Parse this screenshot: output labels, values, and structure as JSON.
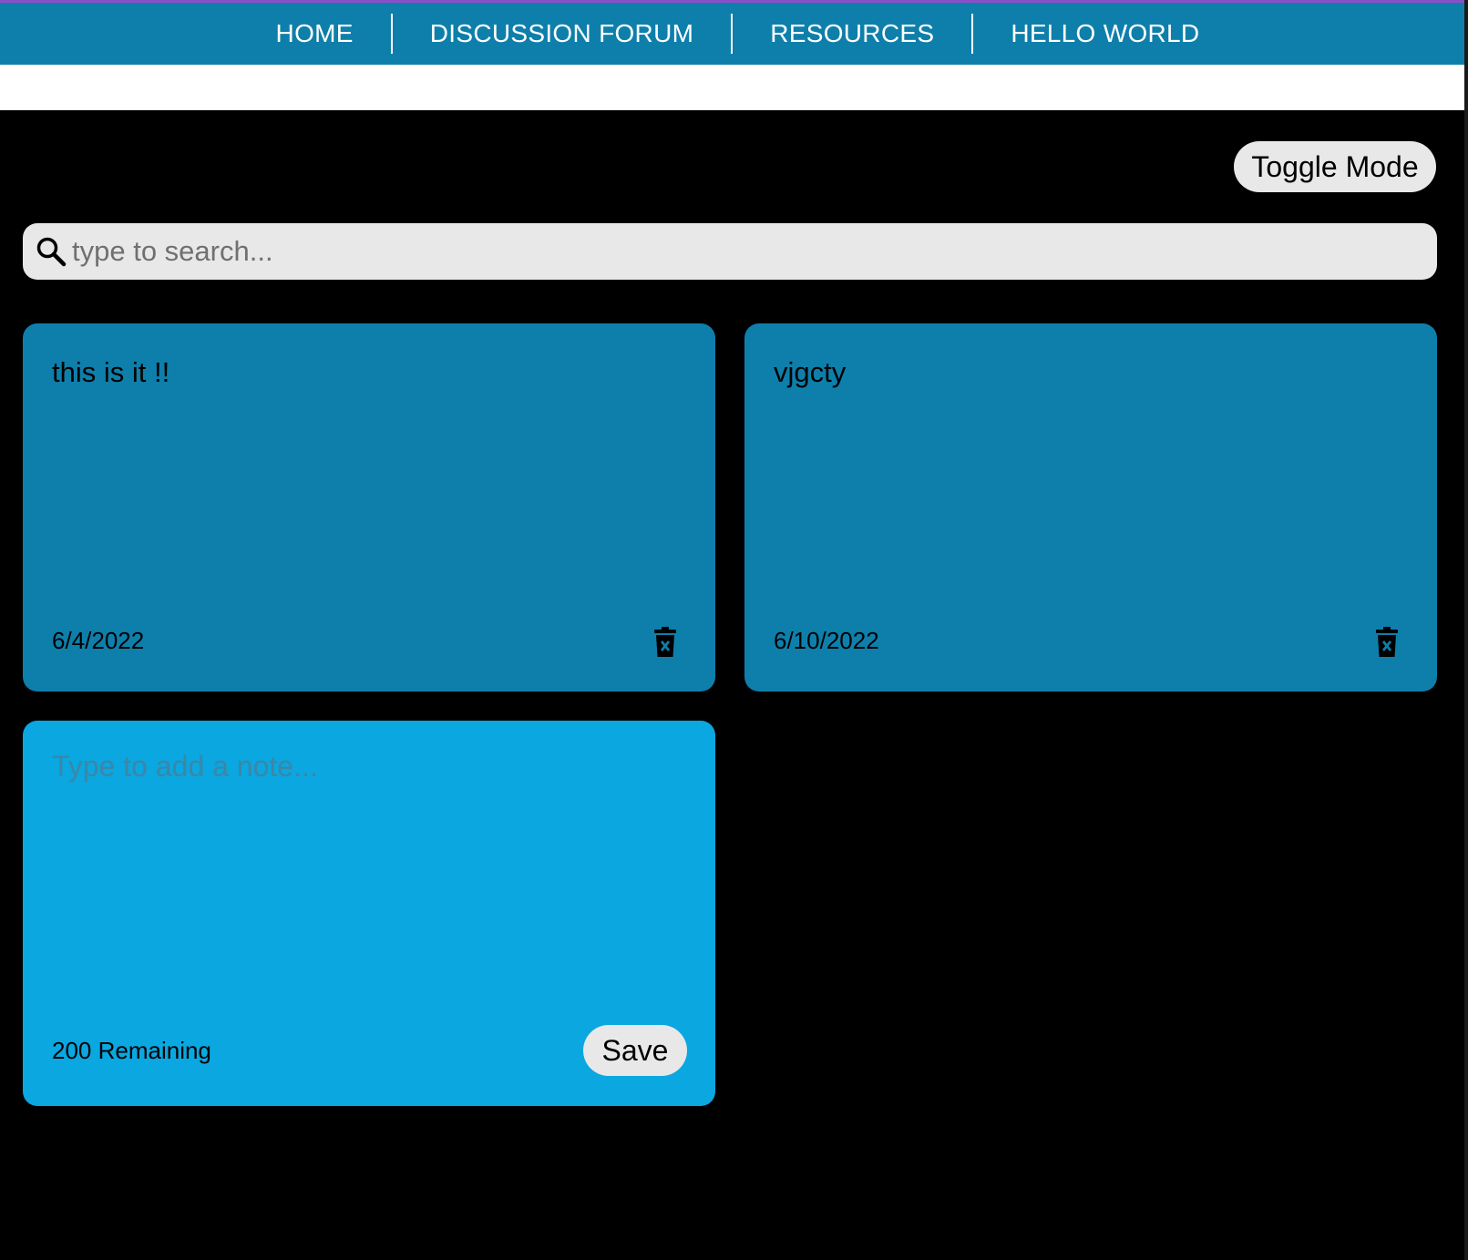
{
  "nav": {
    "items": [
      "HOME",
      "DISCUSSION FORUM",
      "RESOURCES",
      "HELLO WORLD"
    ]
  },
  "toggle_mode_label": "Toggle Mode",
  "search": {
    "placeholder": "type to search..."
  },
  "notes": [
    {
      "text": "this is it !!",
      "date": "6/4/2022"
    },
    {
      "text": "vjgcty",
      "date": "6/10/2022"
    }
  ],
  "new_note": {
    "placeholder": "Type to add a note...",
    "remaining": "200 Remaining",
    "save_label": "Save"
  },
  "colors": {
    "nav_bg": "#0e7fab",
    "note_bg": "#0e7fab",
    "new_note_bg": "#0aa7e0",
    "page_bg": "#000000",
    "control_bg": "#e8e8e8"
  },
  "icons": {
    "search": "search-icon",
    "delete": "trash-icon"
  }
}
